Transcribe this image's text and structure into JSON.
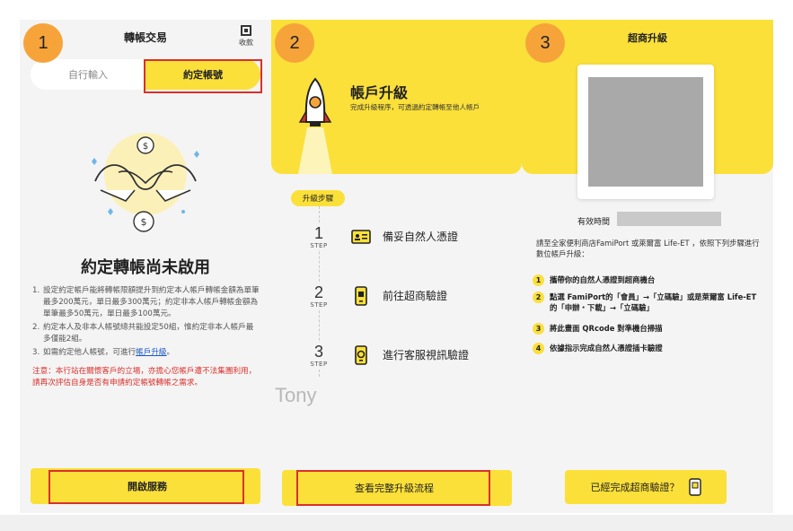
{
  "panel1": {
    "badge": "1",
    "title": "轉帳交易",
    "qr_label": "收款",
    "tabs": [
      "自行輸入",
      "約定帳號"
    ],
    "heading": "約定轉帳尚未啟用",
    "list": [
      {
        "num": "1.",
        "text": "設定約定帳戶能將轉帳限額提升到約定本人帳戶轉帳金額為單筆最多200萬元，單日最多300萬元；約定非本人帳戶轉帳金額為單筆最多50萬元，單日最多100萬元。"
      },
      {
        "num": "2.",
        "text": "約定本人及非本人帳號總共能設定50組，惟約定非本人帳戶最多僅能2組。"
      }
    ],
    "item3_prefix": "如需約定他人帳號，可進行",
    "item3_link": "帳戶升級",
    "item3_suffix": "。",
    "item3_num": "3.",
    "warning": "注意：本行站在關懷客戶的立場，亦擔心您帳戶遭不法集團利用，請再次評估自身是否有申請約定帳號轉帳之需求。",
    "button": "開啟服務"
  },
  "panel2": {
    "badge": "2",
    "hero_title": "帳戶升級",
    "hero_subtitle": "完成升級程序，可透過約定轉帳至他人帳戶",
    "pill": "升級步驟",
    "step_word": "STEP",
    "steps": [
      {
        "num": "1",
        "text": "備妥自然人憑證"
      },
      {
        "num": "2",
        "text": "前往超商驗證"
      },
      {
        "num": "3",
        "text": "進行客服視訊驗證"
      }
    ],
    "watermark": "Tony",
    "button": "查看完整升級流程"
  },
  "panel3": {
    "badge": "3",
    "title": "超商升級",
    "valid_label": "有效時間",
    "intro": "請至全家便利商店FamiPort 或萊爾富 Life-ET ，依照下列步驟進行數位帳戶升級：",
    "steps": [
      {
        "num": "1",
        "text": "攜帶你的自然人憑證到超商機台"
      },
      {
        "num": "2",
        "text": "點選 FamiPort的「會員」→「立碼驗」或是萊爾富 Life-ET的「申辦・下載」→「立碼驗」"
      },
      {
        "num": "3",
        "text": "將此畫面 QRcode 對準機台掃描"
      },
      {
        "num": "4",
        "text": "依據指示完成自然人憑證插卡驗證"
      }
    ],
    "button": "已經完成超商驗證？"
  },
  "colors": {
    "accent": "#fbe03a",
    "badge": "#f6a43a",
    "highlight": "#d9302b",
    "link": "#1a57c4"
  }
}
